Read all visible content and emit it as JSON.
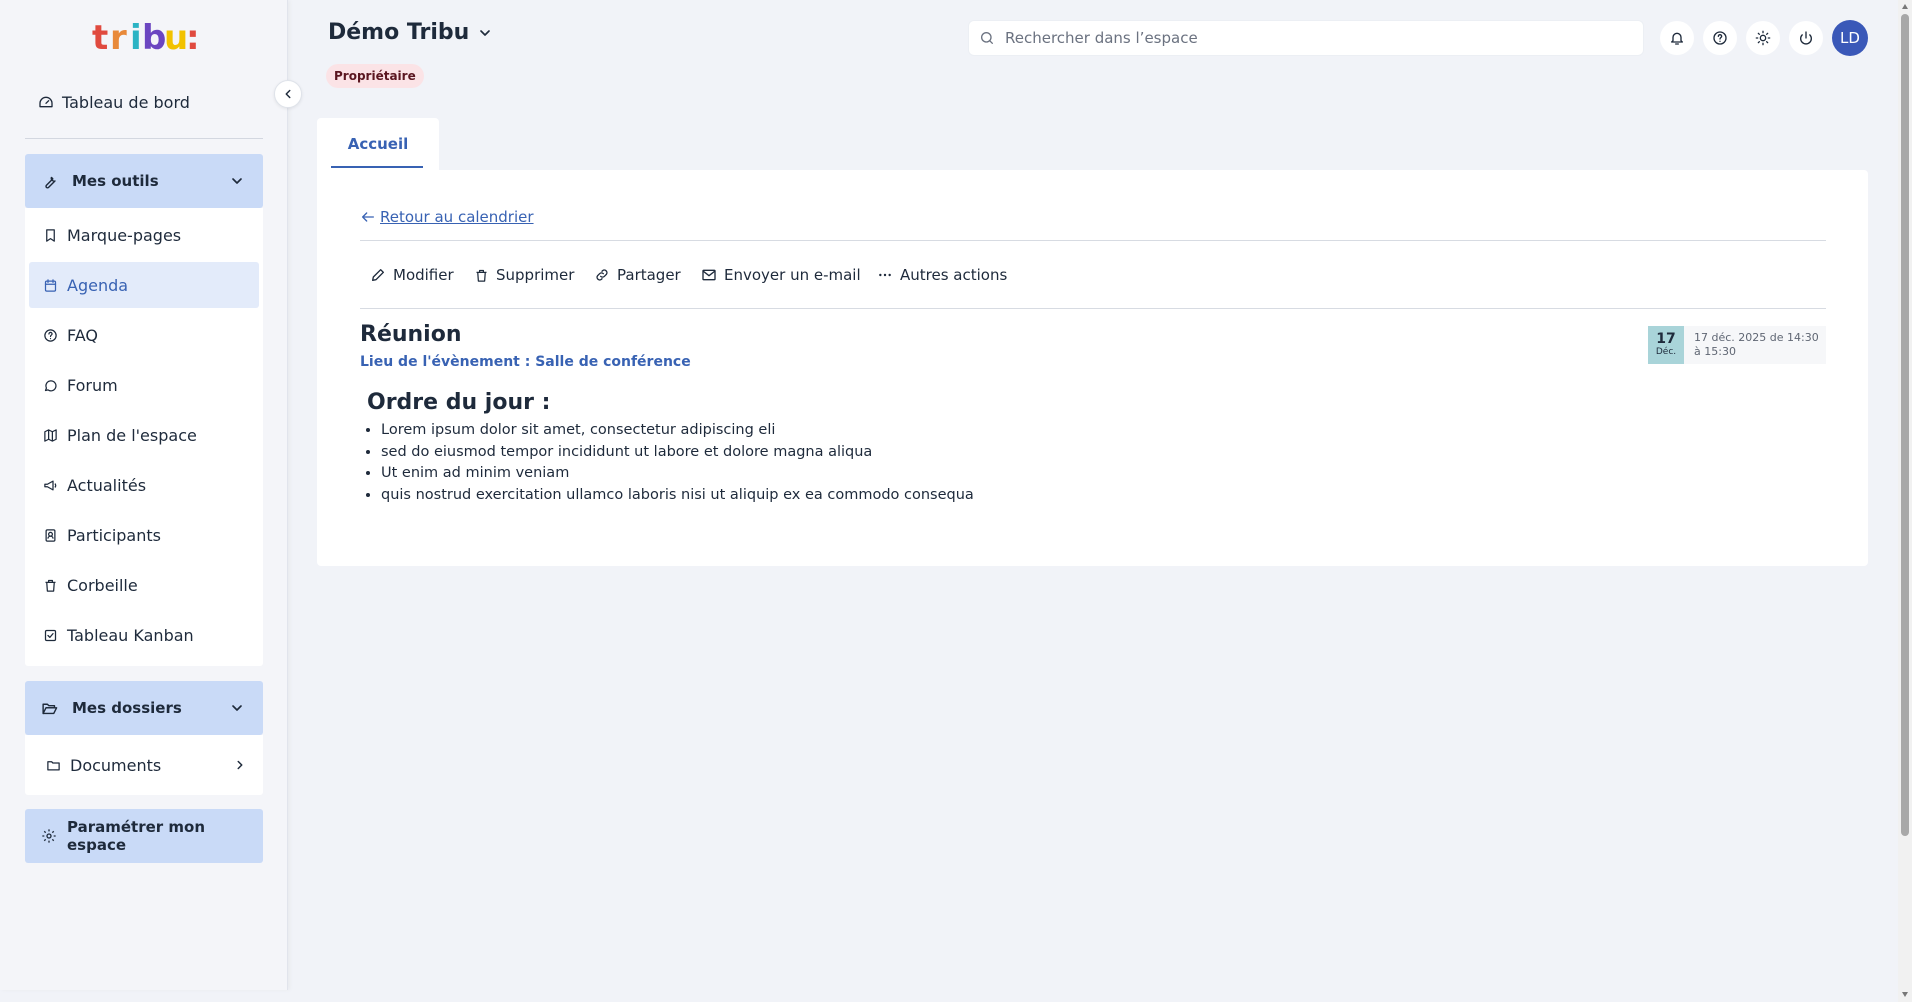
{
  "logo": {
    "letters": [
      "t",
      "r",
      "i",
      "b",
      "u",
      ":"
    ],
    "colors": [
      "#e04a3f",
      "#e8893a",
      "#2bb3c4",
      "#6b46c1",
      "#f2c200",
      "#e04a3f"
    ]
  },
  "sidebar": {
    "dashboard_label": "Tableau de bord",
    "tools_label": "Mes outils",
    "tools_items": [
      {
        "label": "Marque-pages",
        "icon": "bookmark-icon"
      },
      {
        "label": "Agenda",
        "icon": "calendar-icon"
      },
      {
        "label": "FAQ",
        "icon": "help-circle-icon"
      },
      {
        "label": "Forum",
        "icon": "chat-icon"
      },
      {
        "label": "Plan de l'espace",
        "icon": "map-icon"
      },
      {
        "label": "Actualités",
        "icon": "megaphone-icon"
      },
      {
        "label": "Participants",
        "icon": "contacts-icon"
      },
      {
        "label": "Corbeille",
        "icon": "trash-icon"
      },
      {
        "label": "Tableau Kanban",
        "icon": "checkbox-icon"
      }
    ],
    "active_item": "Agenda",
    "folders_label": "Mes dossiers",
    "folders_items": [
      {
        "label": "Documents",
        "icon": "folder-icon"
      }
    ],
    "settings_label": "Paramétrer mon espace"
  },
  "header": {
    "space_title": "Démo Tribu",
    "role_badge": "Propriétaire",
    "search_placeholder": "Rechercher dans l’espace",
    "avatar_initials": "LD"
  },
  "tabs": [
    {
      "label": "Accueil"
    }
  ],
  "event": {
    "back_label": "Retour au calendrier",
    "actions": [
      {
        "label": "Modifier",
        "icon": "pencil-icon"
      },
      {
        "label": "Supprimer",
        "icon": "trash-icon"
      },
      {
        "label": "Partager",
        "icon": "link-icon"
      },
      {
        "label": "Envoyer un e-mail",
        "icon": "mail-icon"
      },
      {
        "label": "Autres actions",
        "icon": "more-icon"
      }
    ],
    "title": "Réunion",
    "location": "Lieu de l'évènement : Salle de conférence",
    "date_day": "17",
    "date_month": "Déc.",
    "date_text": "17 déc. 2025 de 14:30 à 15:30",
    "agenda_title": "Ordre du jour :",
    "agenda_items": [
      "Lorem ipsum dolor sit amet, consectetur adipiscing eli",
      "sed do eiusmod tempor incididunt ut labore et dolore magna aliqua",
      "Ut enim ad minim veniam",
      "quis nostrud exercitation ullamco laboris nisi ut aliquip ex ea commodo consequa"
    ]
  },
  "colors": {
    "accent": "#3862b3",
    "sidebar_header": "#c9daf7",
    "active_bg": "#e3ebfa",
    "badge_bg": "#fbe3e6",
    "date_box": "#a9d4d9",
    "avatar": "#3a58b8"
  }
}
